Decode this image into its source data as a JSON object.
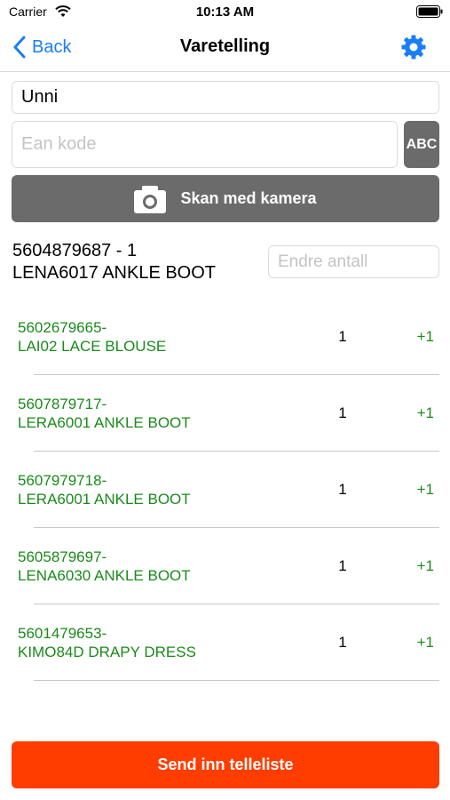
{
  "status_bar": {
    "carrier": "Carrier",
    "time": "10:13 AM"
  },
  "nav": {
    "back_label": "Back",
    "title": "Varetelling",
    "accent_color": "#1a7df5"
  },
  "user_field": {
    "value": "Unni"
  },
  "ean_field": {
    "value": "",
    "placeholder": "Ean kode"
  },
  "abc_button": {
    "label": "ABC"
  },
  "scan_button": {
    "label": "Skan med kamera",
    "icon": "camera-icon"
  },
  "current_item": {
    "code_line": "5604879687 - 1",
    "name": "LENA6017 ANKLE BOOT"
  },
  "quantity_field": {
    "value": "",
    "placeholder": "Endre antall"
  },
  "items": [
    {
      "code": "5602679665-",
      "name": "LAI02 LACE BLOUSE",
      "count": "1",
      "increment": "+1"
    },
    {
      "code": "5607879717-",
      "name": "LERA6001 ANKLE BOOT",
      "count": "1",
      "increment": "+1"
    },
    {
      "code": "5607979718-",
      "name": "LERA6001 ANKLE BOOT",
      "count": "1",
      "increment": "+1"
    },
    {
      "code": "5605879697-",
      "name": "LENA6030 ANKLE BOOT",
      "count": "1",
      "increment": "+1"
    },
    {
      "code": "5601479653-",
      "name": "KIMO84D DRAPY DRESS",
      "count": "1",
      "increment": "+1"
    }
  ],
  "send_button": {
    "label": "Send inn telleliste",
    "color": "#ff3d00"
  },
  "item_text_color": "#1a8a1a"
}
